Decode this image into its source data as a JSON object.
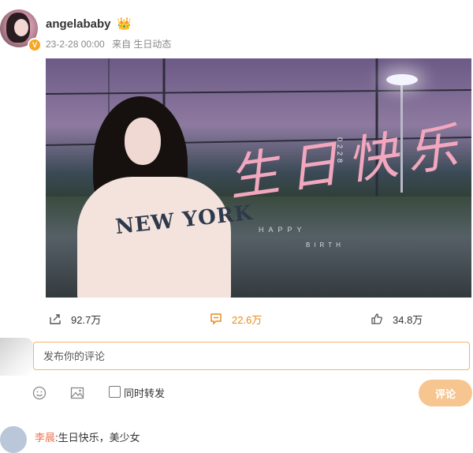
{
  "post": {
    "username": "angelababy",
    "user_badge": "👑",
    "verified_badge": "V",
    "date": "23-2-28 00:00",
    "source": "来自 生日动态",
    "image": {
      "script_text": "生日快乐",
      "date_code": "0228",
      "happy_text": "HAPPY",
      "birth_text": "BIRTH",
      "sweater_text": "NEW YORK"
    }
  },
  "actions": {
    "repost_count": "92.7万",
    "comment_count": "22.6万",
    "like_count": "34.8万"
  },
  "comment_input": {
    "placeholder": "发布你的评论",
    "also_repost_label": "同时转发",
    "submit_label": "评论"
  },
  "next_comment": {
    "name": "李晨",
    "text": ":生日快乐，美少女"
  },
  "colors": {
    "accent": "#e8891b",
    "submit_bg": "#f7c690",
    "input_border": "#f0b66a"
  }
}
